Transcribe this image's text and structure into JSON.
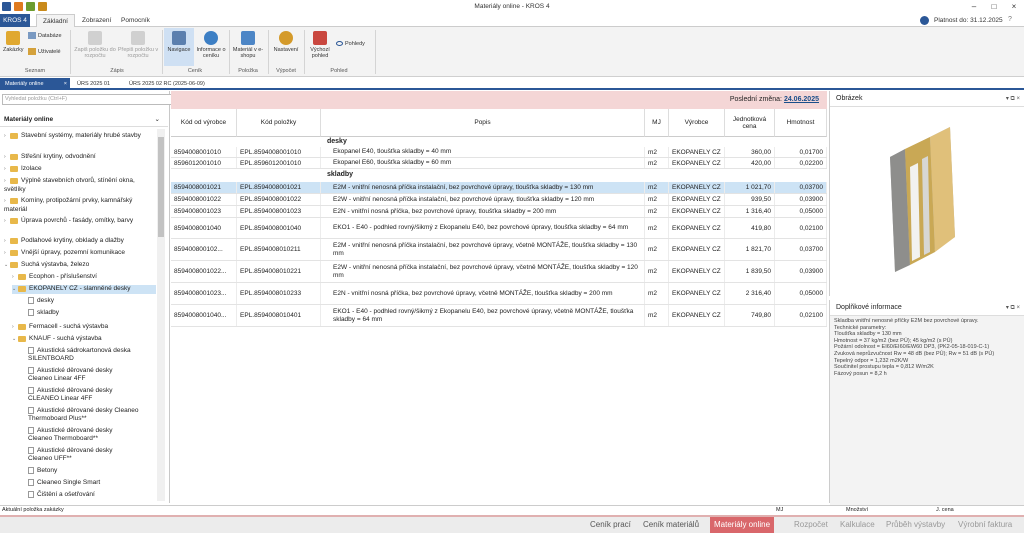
{
  "window": {
    "title": "Materiály online - KROS 4"
  },
  "menu": {
    "kros": "KROS 4",
    "tabs": [
      "Základní",
      "Zobrazení",
      "Pomocník"
    ],
    "validity": "Platnost do: 31.12.2025"
  },
  "ribbon": {
    "buttons": [
      "Zakázky",
      "Databáze",
      "Uživatelé",
      "Zapiš položku do rozpočtu",
      "Přepiš položku v rozpočtu",
      "Navigace",
      "Informace o ceníku",
      "Materiál v e-shopu",
      "Nastavení",
      "Výchozí pohled",
      "Pohledy"
    ],
    "groups": [
      "Seznam",
      "Zápis",
      "Ceník",
      "Položka",
      "Výpočet",
      "Pohled"
    ]
  },
  "doc_tabs": [
    "Materiály online",
    "ÚRS 2025 01",
    "ÚRS 2025 02 RC (2025-06-09)"
  ],
  "left": {
    "search_placeholder": "Vyhledat položku (Ctrl+F)",
    "header": "Materiály online",
    "tree": [
      "Stavební systémy, materiály hrubé stavby",
      "Střešní krytiny, odvodnění",
      "Izolace",
      "Výplně stavebních otvorů, stínění okna, světlíky",
      "Komíny, protipožární prvky, kamnářský materiál",
      "Úprava povrchů - fasády, omítky, barvy",
      "Podlahové krytiny, obklady a dlažby",
      "Vnější úpravy, pozemní komunikace",
      "Suchá výstavba, železo",
      "Ecophon - příslušenství",
      "EKOPANELY CZ - slamněné desky",
      "desky",
      "skladby",
      "Fermacell - suchá výstavba",
      "KNAUF - suchá výstavba",
      "Akustická sádrokartonová deska SILENTBOARD",
      "Akustické děrované desky Cleaneo Linear 4FF",
      "Akustické děrované desky CLEANEO Linear 4FF",
      "Akustické děrované desky Cleaneo Thermoboard Plus**",
      "Akustické děrované desky Cleaneo Thermoboard**",
      "Akustické děrované desky Cleaneo UFF**",
      "Betony",
      "Cleaneo Single Smart",
      "Čištění a ošetřování"
    ]
  },
  "main": {
    "last_change_label": "Poslední změna:",
    "last_change_date": "24.06.2025",
    "columns": [
      "Kód od výrobce",
      "Kód položky",
      "Popis",
      "MJ",
      "Výrobce",
      "Jednotková cena",
      "Hmotnost"
    ],
    "group_desky": "desky",
    "group_skladby": "skladby",
    "rows": [
      [
        "8594008001010",
        "EPL.8594008001010",
        "Ekopanel E40, tloušťka skladby = 40 mm",
        "m2",
        "EKOPANELY CZ",
        "360,00",
        "0,01700"
      ],
      [
        "8596012001010",
        "EPL.8596012001010",
        "Ekopanel E60, tloušťka skladby = 60 mm",
        "m2",
        "EKOPANELY CZ",
        "420,00",
        "0,02200"
      ],
      [
        "8594008001021",
        "EPL.8594008001021",
        "E2M - vnitřní nenosná příčka instalační, bez povrchové úpravy, tloušťka skladby = 130 mm",
        "m2",
        "EKOPANELY CZ",
        "1 021,70",
        "0,03700"
      ],
      [
        "8594008001022",
        "EPL.8594008001022",
        "E2W - vnitřní nenosná příčka instalační, bez povrchové úpravy, tloušťka skladby = 120 mm",
        "m2",
        "EKOPANELY CZ",
        "939,50",
        "0,03900"
      ],
      [
        "8594008001023",
        "EPL.8594008001023",
        "E2N - vnitřní nosná příčka, bez povrchové úpravy, tloušťka skladby = 200 mm",
        "m2",
        "EKOPANELY CZ",
        "1 316,40",
        "0,05000"
      ],
      [
        "8594008001040",
        "EPL.8594008001040",
        "EKO1 - E40 - podhled rovný/šikmý z Ekopanelu E40, bez povrchové úpravy, tloušťka skladby = 64 mm",
        "m2",
        "EKOPANELY CZ",
        "419,80",
        "0,02100"
      ],
      [
        "859400800102...",
        "EPL.8594008010211",
        "E2M - vnitřní nenosná příčka instalační, bez povrchové úpravy, včetně MONTÁŽE, tloušťka skladby = 130 mm",
        "m2",
        "EKOPANELY CZ",
        "1 821,70",
        "0,03700"
      ],
      [
        "8594008001022...",
        "EPL.8594008010221",
        "E2W - vnitřní nenosná příčka instalační, bez povrchové úpravy, včetně MONTÁŽE, tloušťka skladby = 120 mm",
        "m2",
        "EKOPANELY CZ",
        "1 839,50",
        "0,03900"
      ],
      [
        "8594008001023...",
        "EPL.8594008010233",
        "E2N - vnitřní nosná příčka, bez povrchové úpravy, včetně MONTÁŽE, tloušťka skladby = 200 mm",
        "m2",
        "EKOPANELY CZ",
        "2 316,40",
        "0,05000"
      ],
      [
        "8594008001040...",
        "EPL.8594008010401",
        "EKO1 - E40 - podhled rovný/šikmý z Ekopanelu E40, bez povrchové úpravy, včetně MONTÁŽE, tloušťka skladby = 64 mm",
        "m2",
        "EKOPANELY CZ",
        "749,80",
        "0,02100"
      ]
    ]
  },
  "right": {
    "image_title": "Obrázek",
    "info_title": "Doplňkové informace",
    "info_lines": [
      "Skladba vnitřní nenosné příčky E2M bez povrchové úpravy.",
      "Technické parametry:",
      "Tloušťka skladby = 130 mm",
      "Hmotnost = 37 kg/m2 (bez PÚ); 45 kg/m2 (s PÚ)",
      "Požární odolnost = EI60/EI60/EW60 DP3, (PK2-05-18-019-C-1)",
      "Zvuková neprůzvučnost Rw = 48 dB (bez PÚ); Rw = 51 dB (s PÚ)",
      "Tepelný odpor = 1,232 m2K/W",
      "Součinitel prostupu tepla = 0,812 W/m2K",
      "Fázový posun = 8,2 h"
    ]
  },
  "status": {
    "left": "Aktuální položka zakázky",
    "mj": "MJ",
    "qty": "Množství",
    "price": "J. cena"
  },
  "bottom": [
    "Ceník prací",
    "Ceník materiálů",
    "Materiály online",
    "Rozpočet",
    "Kalkulace",
    "Průběh výstavby",
    "Výrobní faktura"
  ],
  "colors": {
    "accent": "#2b5797",
    "highlight": "#d9676b",
    "selection": "#cde3f5"
  }
}
